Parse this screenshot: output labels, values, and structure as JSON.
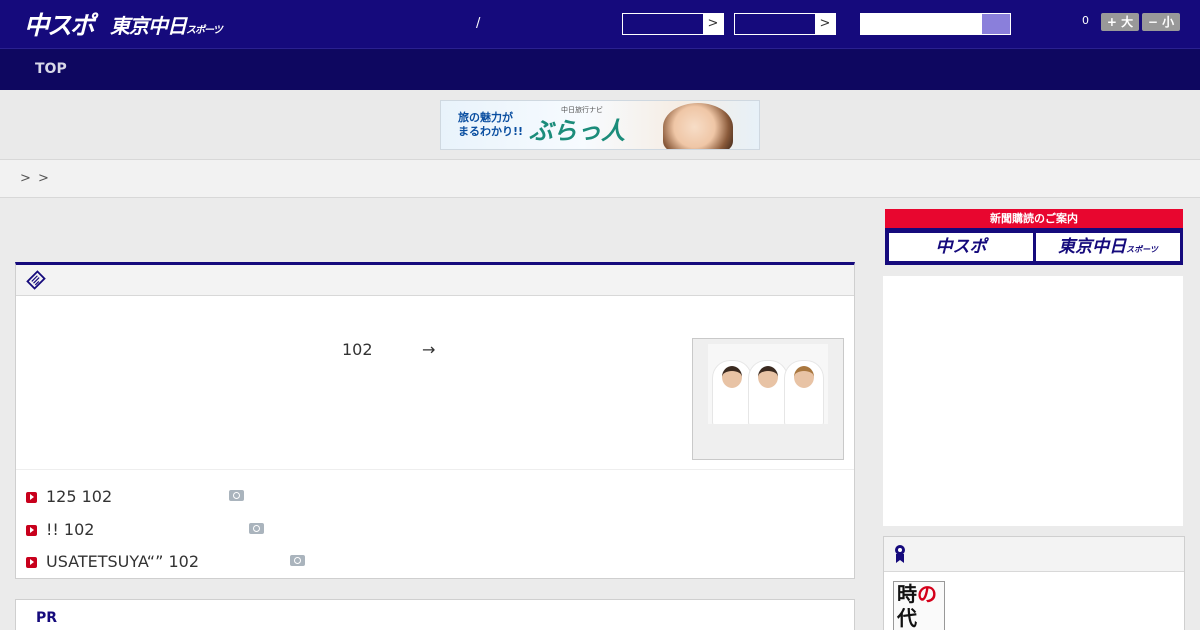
{
  "header": {
    "logo_main": "中スポ",
    "logo_tokyo": "東京中日",
    "logo_tokyo_sub": "スポーツ",
    "separator": "/",
    "select_arrow": ">",
    "count": "0",
    "font_larger": "+ 大",
    "font_smaller": "− 小"
  },
  "nav": {
    "top_label": "TOP"
  },
  "ad_banner": {
    "line1": "旅の魅力が",
    "line2": "まるわかり!!",
    "small": "中日旅行ナビ",
    "brand": "ぶらっ人"
  },
  "breadcrumb": {
    "sep1": ">",
    "sep2": ">"
  },
  "article": {
    "lead_number": "102",
    "lead_arrow": "→",
    "related": [
      {
        "text": "125 102"
      },
      {
        "text": "!! 102"
      },
      {
        "text": "USATETSUYA“” 102"
      }
    ]
  },
  "pr": {
    "label": "PR"
  },
  "subscription": {
    "title": "新聞購読のご案内",
    "chuspo": "中スポ",
    "tokyo": "東京中日",
    "tokyo_sub": "スポーツ"
  },
  "widget": {
    "thumb_a": "時",
    "thumb_b": "代",
    "thumb_small": "の"
  },
  "colors": {
    "header_bg": "#150a7c",
    "nav_bg": "#0e0760",
    "accent_red": "#e8062f",
    "bullet_red": "#c8001c"
  },
  "icons": {
    "article_header": "ticket-icon",
    "widget_header": "ribbon-icon",
    "related_bullet": "play-bullet-icon",
    "related_photo": "camera-icon"
  }
}
